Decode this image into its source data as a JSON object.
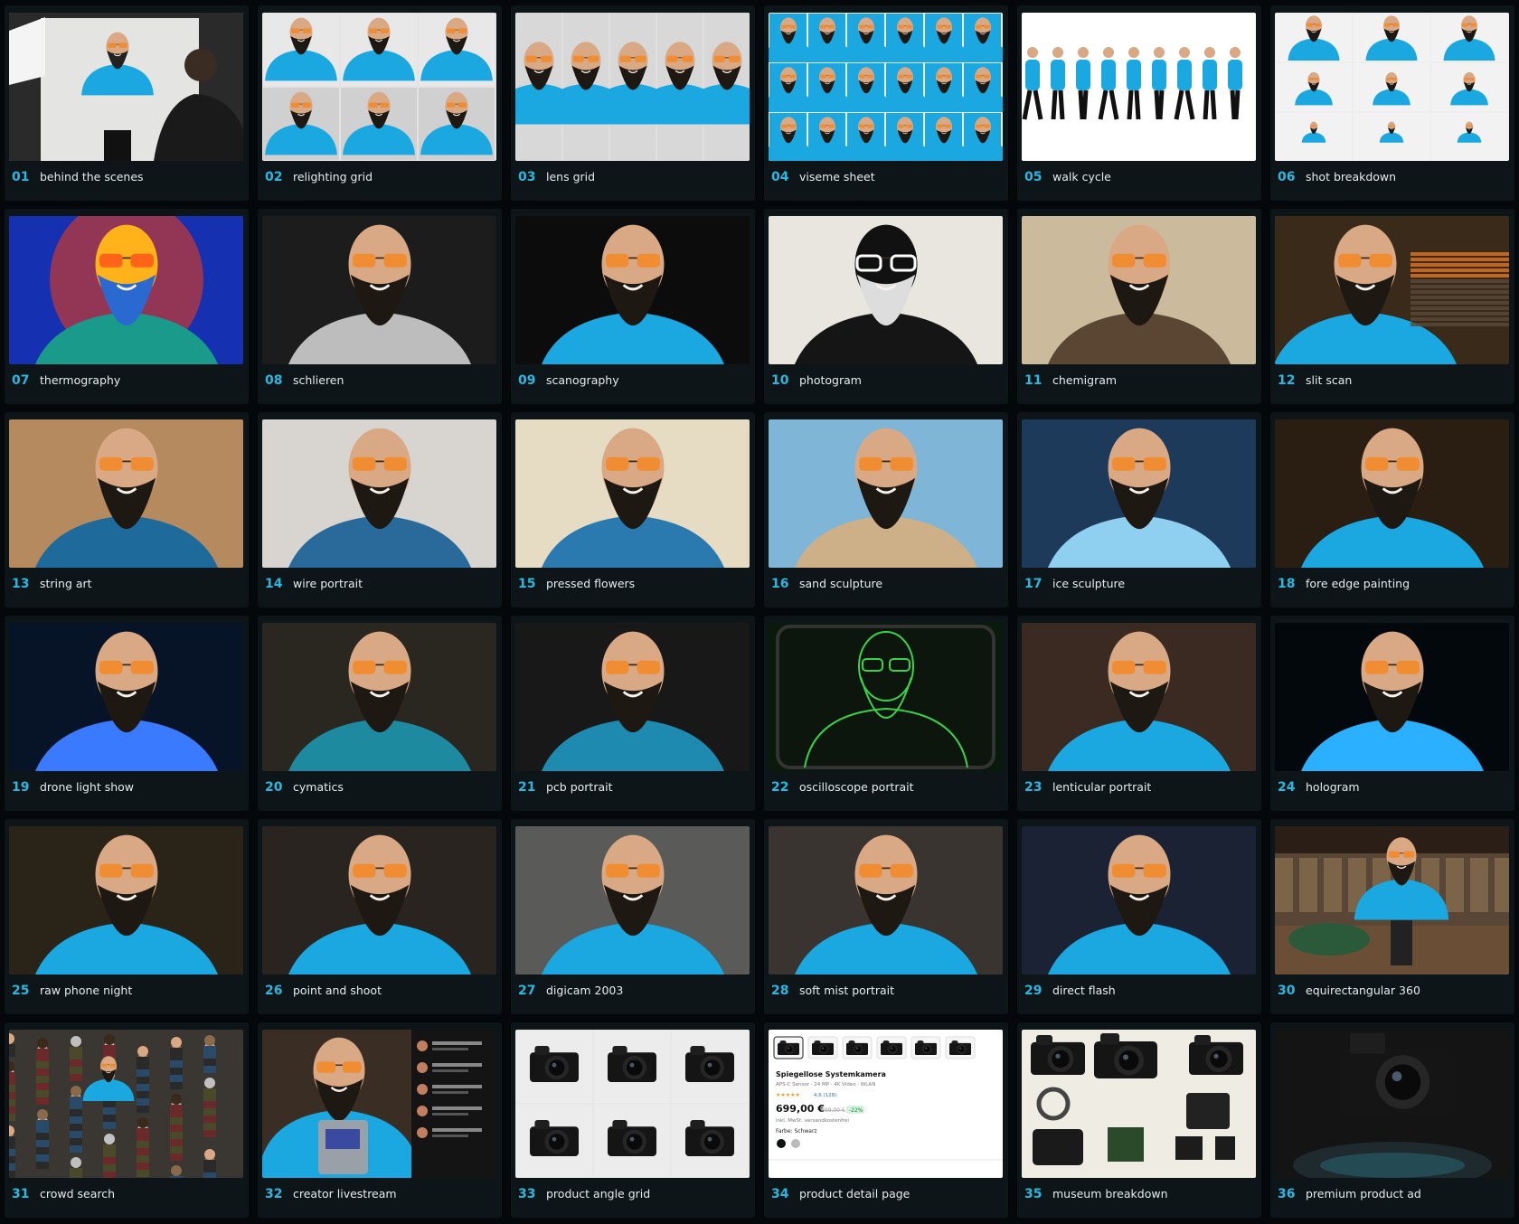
{
  "gallery": {
    "accent_color": "#2bb8e0",
    "items": [
      {
        "number": "01",
        "label": "behind the scenes",
        "icon": "studio-photo",
        "bg": "#d7d7d3",
        "accent": "#1ba8e0",
        "style": "studio"
      },
      {
        "number": "02",
        "label": "relighting grid",
        "icon": "portrait-grid",
        "bg": "#e3e3e3",
        "accent": "#1ba8e0",
        "style": "grid6"
      },
      {
        "number": "03",
        "label": "lens grid",
        "icon": "portrait-row",
        "bg": "#e0e0e0",
        "accent": "#1ba8e0",
        "style": "row5"
      },
      {
        "number": "04",
        "label": "viseme sheet",
        "icon": "portrait-sheet",
        "bg": "#ececec",
        "accent": "#1ba8e0",
        "style": "grid18"
      },
      {
        "number": "05",
        "label": "walk cycle",
        "icon": "walking-figures",
        "bg": "#ffffff",
        "accent": "#1ba8e0",
        "style": "walk"
      },
      {
        "number": "06",
        "label": "shot breakdown",
        "icon": "shot-grid",
        "bg": "#eeeeee",
        "accent": "#1ba8e0",
        "style": "grid9"
      },
      {
        "number": "07",
        "label": "thermography",
        "icon": "thermal-portrait",
        "bg": "#1a2fb0",
        "accent": "#ff8a00",
        "style": "thermal"
      },
      {
        "number": "08",
        "label": "schlieren",
        "icon": "mono-portrait",
        "bg": "#1c1c1c",
        "accent": "#bdbdbd",
        "style": "portrait"
      },
      {
        "number": "09",
        "label": "scanography",
        "icon": "portrait",
        "bg": "#0c0c0c",
        "accent": "#1ba8e0",
        "style": "portrait"
      },
      {
        "number": "10",
        "label": "photogram",
        "icon": "silhouette-portrait",
        "bg": "#e9e6df",
        "accent": "#111111",
        "style": "photogram"
      },
      {
        "number": "11",
        "label": "chemigram",
        "icon": "sepia-portrait",
        "bg": "#cbbb9c",
        "accent": "#5a4632",
        "style": "portrait"
      },
      {
        "number": "12",
        "label": "slit scan",
        "icon": "portrait",
        "bg": "#3a2a1a",
        "accent": "#1ba8e0",
        "style": "slitscan"
      },
      {
        "number": "13",
        "label": "string art",
        "icon": "string-portrait",
        "bg": "#b58a5e",
        "accent": "#1e6a9a",
        "style": "portrait"
      },
      {
        "number": "14",
        "label": "wire portrait",
        "icon": "wire-portrait",
        "bg": "#d8d4cf",
        "accent": "#2a6a9a",
        "style": "portrait"
      },
      {
        "number": "15",
        "label": "pressed flowers",
        "icon": "flower-portrait",
        "bg": "#e6dcc4",
        "accent": "#2a7ab0",
        "style": "portrait"
      },
      {
        "number": "16",
        "label": "sand sculpture",
        "icon": "sand-portrait",
        "bg": "#7fb6d8",
        "accent": "#cdb088",
        "style": "portrait"
      },
      {
        "number": "17",
        "label": "ice sculpture",
        "icon": "ice-portrait",
        "bg": "#1d3a5a",
        "accent": "#8fd0f0",
        "style": "portrait"
      },
      {
        "number": "18",
        "label": "fore edge painting",
        "icon": "book-portrait",
        "bg": "#2a1d12",
        "accent": "#1ba8e0",
        "style": "portrait"
      },
      {
        "number": "19",
        "label": "drone light show",
        "icon": "dots-portrait",
        "bg": "#071428",
        "accent": "#3a7aff",
        "style": "portrait"
      },
      {
        "number": "20",
        "label": "cymatics",
        "icon": "pattern-portrait",
        "bg": "#2a2620",
        "accent": "#1e8aa0",
        "style": "portrait"
      },
      {
        "number": "21",
        "label": "pcb portrait",
        "icon": "circuit-portrait",
        "bg": "#181818",
        "accent": "#1e8ab0",
        "style": "portrait"
      },
      {
        "number": "22",
        "label": "oscilloscope portrait",
        "icon": "scope-portrait",
        "bg": "#0a1a0a",
        "accent": "#3ad24a",
        "style": "scope"
      },
      {
        "number": "23",
        "label": "lenticular portrait",
        "icon": "portrait",
        "bg": "#3a2a22",
        "accent": "#1ba8e0",
        "style": "portrait"
      },
      {
        "number": "24",
        "label": "hologram",
        "icon": "hologram-portrait",
        "bg": "#03080c",
        "accent": "#2ab0ff",
        "style": "portrait"
      },
      {
        "number": "25",
        "label": "raw phone night",
        "icon": "portrait",
        "bg": "#2a2418",
        "accent": "#1ba8e0",
        "style": "portrait"
      },
      {
        "number": "26",
        "label": "point and shoot",
        "icon": "portrait",
        "bg": "#2a2420",
        "accent": "#1ba8e0",
        "style": "portrait"
      },
      {
        "number": "27",
        "label": "digicam 2003",
        "icon": "portrait",
        "bg": "#5a5a58",
        "accent": "#1ba8e0",
        "style": "portrait"
      },
      {
        "number": "28",
        "label": "soft mist portrait",
        "icon": "portrait",
        "bg": "#3a3430",
        "accent": "#1ba8e0",
        "style": "portrait"
      },
      {
        "number": "29",
        "label": "direct flash",
        "icon": "portrait",
        "bg": "#1a2234",
        "accent": "#1ba8e0",
        "style": "portrait"
      },
      {
        "number": "30",
        "label": "equirectangular 360",
        "icon": "panorama",
        "bg": "#5a4636",
        "accent": "#1ba8e0",
        "style": "panorama"
      },
      {
        "number": "31",
        "label": "crowd search",
        "icon": "crowd",
        "bg": "#3a3632",
        "accent": "#1ba8e0",
        "style": "crowd"
      },
      {
        "number": "32",
        "label": "creator livestream",
        "icon": "livestream",
        "bg": "#3a2e24",
        "accent": "#1ba8e0",
        "style": "stream"
      },
      {
        "number": "33",
        "label": "product angle grid",
        "icon": "camera-grid",
        "bg": "#e8e8e8",
        "accent": "#111111",
        "style": "cams"
      },
      {
        "number": "34",
        "label": "product detail page",
        "icon": "shop-page",
        "bg": "#ffffff",
        "accent": "#111111",
        "style": "shop"
      },
      {
        "number": "35",
        "label": "museum breakdown",
        "icon": "camera-parts",
        "bg": "#efece4",
        "accent": "#111111",
        "style": "parts"
      },
      {
        "number": "36",
        "label": "premium product ad",
        "icon": "camera-ad",
        "bg": "#141414",
        "accent": "#2a6a7a",
        "style": "ad"
      }
    ],
    "shop_page": {
      "title": "Spiegellose Systemkamera",
      "specs": "APS-C Sensor · 24 MP · 4K Video · WLAN",
      "price": "699,00 €",
      "old_price": "899,00 €",
      "discount": "-22%",
      "rating": "4,6 (128)",
      "tax_note": "inkl. MwSt. versandkostenfrei",
      "color_label": "Farbe: Schwarz"
    }
  }
}
